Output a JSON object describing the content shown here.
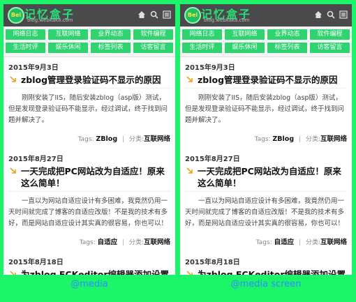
{
  "site": {
    "logo_badge": "Bei",
    "logo_title": "记忆盒子",
    "logo_sub": "blog.webkaka.com"
  },
  "nav": [
    "网络日志",
    "互联网络",
    "业界动态",
    "软件编程",
    "生活时评",
    "娱乐休闲",
    "标签列表",
    "访客留言"
  ],
  "posts": [
    {
      "date": "2015年9月3日",
      "title": "zblog管理登录验证码不显示的原因",
      "body": "刚刚安装了IIS，随后安装zblog（asp版）测试，但是发现登录验证码不能显示，经过调试，终于找到问题并解决了。",
      "tags_label": "Tags:",
      "tags": "ZBlog",
      "cat_label": "分类:",
      "cat": "互联网络"
    },
    {
      "date": "2015年8月27日",
      "title": "一天完成把PC网站改为自适应！原来这么简单！",
      "body": "一直以为网站自适应设计有多困难，我竟然仍用一天时间就完成了博客的自适应改版！不是我的技术有多好，而是网站自适应设计其实真的很容易，你也可以！",
      "tags_label": "Tags:",
      "tags": "自适应",
      "cat_label": "分类:",
      "cat": "互联网络"
    },
    {
      "date": "2015年8月18日",
      "title": "为zblog FCKeditor编辑器添加设置字体格式"
    }
  ],
  "captions": {
    "left": "@media",
    "right": "@media screen"
  },
  "colors": {
    "background": "#1cf56a",
    "nav_button": "#2fd36f",
    "caption": "#2a8cff",
    "arrow": "#f0a020"
  }
}
